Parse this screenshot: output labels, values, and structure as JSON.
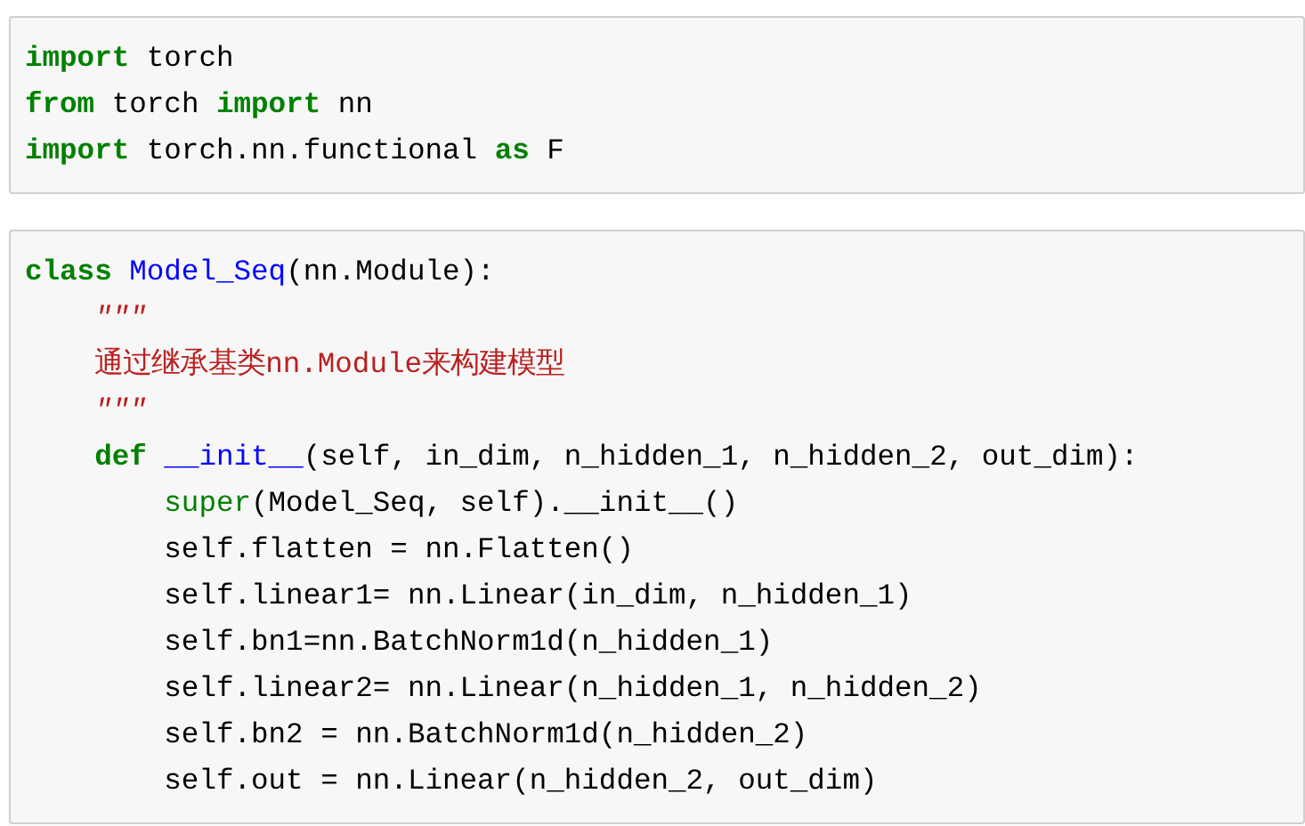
{
  "cells": [
    {
      "lines": [
        [
          {
            "text": "import",
            "kind": "keyword"
          },
          {
            "text": " torch",
            "kind": "plain"
          }
        ],
        [
          {
            "text": "from",
            "kind": "keyword"
          },
          {
            "text": " torch ",
            "kind": "plain"
          },
          {
            "text": "import",
            "kind": "keyword"
          },
          {
            "text": " nn",
            "kind": "plain"
          }
        ],
        [
          {
            "text": "import",
            "kind": "keyword"
          },
          {
            "text": " torch.nn.functional ",
            "kind": "plain"
          },
          {
            "text": "as",
            "kind": "keyword"
          },
          {
            "text": " F",
            "kind": "plain"
          }
        ]
      ]
    },
    {
      "lines": [
        [
          {
            "text": "class ",
            "kind": "keyword"
          },
          {
            "text": "Model_Seq",
            "kind": "name"
          },
          {
            "text": "(nn.Module):",
            "kind": "plain"
          }
        ],
        [
          {
            "text": "    \"\"\"",
            "kind": "docstring"
          }
        ],
        [
          {
            "text": "    通过继承基类nn.Module来构建模型",
            "kind": "string"
          }
        ],
        [
          {
            "text": "    \"\"\"",
            "kind": "docstring"
          }
        ],
        [
          {
            "text": "    def ",
            "kind": "keyword"
          },
          {
            "text": "__init__",
            "kind": "name"
          },
          {
            "text": "(self, in_dim, n_hidden_1, n_hidden_2, out_dim):",
            "kind": "plain"
          }
        ],
        [
          {
            "text": "        super",
            "kind": "builtin"
          },
          {
            "text": "(Model_Seq, self).__init__()",
            "kind": "plain"
          }
        ],
        [
          {
            "text": "        self.flatten = nn.Flatten()",
            "kind": "plain"
          }
        ],
        [
          {
            "text": "        self.linear1= nn.Linear(in_dim, n_hidden_1)",
            "kind": "plain"
          }
        ],
        [
          {
            "text": "        self.bn1=nn.BatchNorm1d(n_hidden_1)",
            "kind": "plain"
          }
        ],
        [
          {
            "text": "        self.linear2= nn.Linear(n_hidden_1, n_hidden_2)",
            "kind": "plain"
          }
        ],
        [
          {
            "text": "        self.bn2 = nn.BatchNorm1d(n_hidden_2)",
            "kind": "plain"
          }
        ],
        [
          {
            "text": "        self.out = nn.Linear(n_hidden_2, out_dim)",
            "kind": "plain"
          }
        ]
      ]
    }
  ]
}
